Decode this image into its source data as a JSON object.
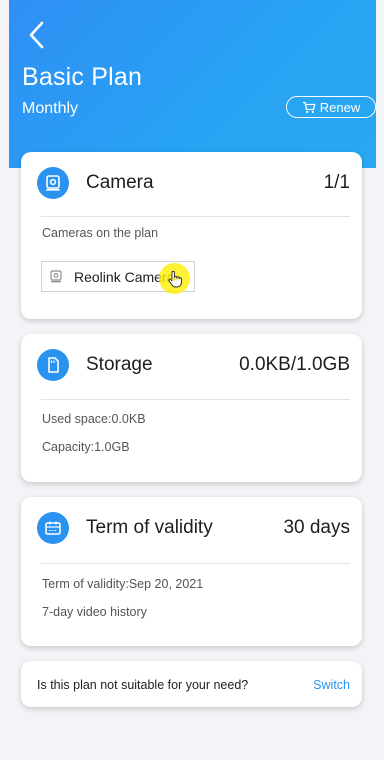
{
  "header": {
    "plan_name": "Basic Plan",
    "period": "Monthly",
    "renew_label": "Renew",
    "gradient_start": "#2f8ff5",
    "gradient_end": "#2aa8f2"
  },
  "camera_card": {
    "title": "Camera",
    "value": "1/1",
    "icon": "camera-icon",
    "section_label": "Cameras on the plan",
    "cameras": [
      "Reolink Camera"
    ]
  },
  "storage_card": {
    "title": "Storage",
    "value": "0.0KB/1.0GB",
    "icon": "storage-icon",
    "used_space": "Used space:0.0KB",
    "capacity": "Capacity:1.0GB"
  },
  "validity_card": {
    "title": "Term of validity",
    "value": "30 days",
    "icon": "calendar-icon",
    "term": "Term of validity:Sep 20, 2021",
    "history": "7-day video history"
  },
  "switch_card": {
    "question": "Is this plan not suitable for your need?",
    "switch_label": "Switch"
  },
  "colors": {
    "accent": "#2a93f0",
    "background": "#f3f4f7",
    "cursor_highlight": "#ffee00"
  }
}
